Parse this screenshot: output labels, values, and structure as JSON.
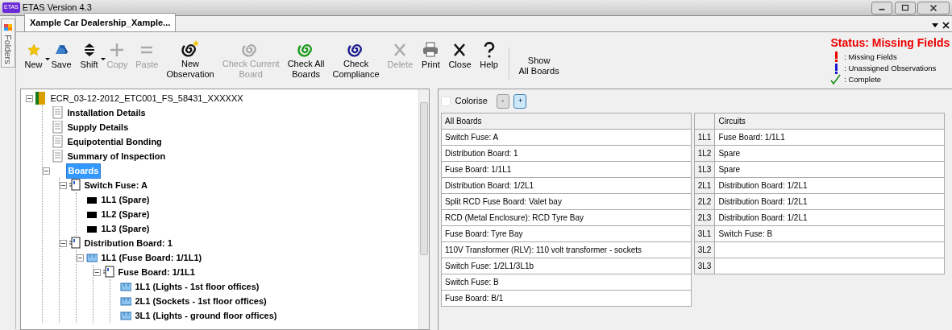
{
  "window": {
    "title": "ETAS Version 4.3",
    "app_badge": "ETAS"
  },
  "side_panel": {
    "label": "Folders"
  },
  "document_tab": {
    "label": "Xample Car Dealership_Xample...",
    "selected": true
  },
  "toolbar": [
    {
      "label": "New",
      "kind": "star",
      "disabled": false,
      "dropdown": true
    },
    {
      "label": "Save",
      "kind": "save",
      "disabled": false,
      "dropdown": false
    },
    {
      "label": "Shift",
      "kind": "shift",
      "disabled": false,
      "dropdown": true
    },
    {
      "label": "Copy",
      "kind": "plus",
      "disabled": true,
      "dropdown": false
    },
    {
      "label": "Paste",
      "kind": "equals",
      "disabled": true,
      "dropdown": false
    },
    {
      "label": "New Observation",
      "kind": "spiralstar",
      "disabled": false,
      "dropdown": false
    },
    {
      "label": "Check Current Board",
      "kind": "spiralgrey",
      "disabled": true,
      "dropdown": false
    },
    {
      "label": "Check All Boards",
      "kind": "spiralgreen",
      "disabled": false,
      "dropdown": false
    },
    {
      "label": "Check Compliance",
      "kind": "spiralblue",
      "disabled": false,
      "dropdown": false
    },
    {
      "label": "Delete",
      "kind": "cross",
      "disabled": true,
      "dropdown": false
    },
    {
      "label": "Print",
      "kind": "printer",
      "disabled": false,
      "dropdown": false
    },
    {
      "label": "Close",
      "kind": "cross",
      "disabled": false,
      "dropdown": false
    },
    {
      "label": "Help",
      "kind": "question",
      "disabled": false,
      "dropdown": false
    },
    {
      "label": "Show All Boards",
      "kind": "text",
      "disabled": false,
      "dropdown": false
    }
  ],
  "status": {
    "title": "Status: Missing Fields",
    "legend": [
      {
        "kind": "missing",
        "label": ": Missing Fields"
      },
      {
        "kind": "unassigned",
        "label": ": Unassigned Observations"
      },
      {
        "kind": "complete",
        "label": ": Complete"
      }
    ]
  },
  "tree": [
    {
      "label": "ECR_03-12-2012_ETC001_FS_58431_XXXXXX",
      "kind": "root",
      "selected": false,
      "expanded": true,
      "children": [
        {
          "label": "Installation Details",
          "kind": "doc",
          "selected": false
        },
        {
          "label": "Supply Details",
          "kind": "doc",
          "selected": false
        },
        {
          "label": "Equipotential Bonding",
          "kind": "doc",
          "selected": false
        },
        {
          "label": "Summary of Inspection",
          "kind": "doc",
          "selected": false
        },
        {
          "label": "Boards",
          "kind": "group",
          "selected": true,
          "expanded": true,
          "children": [
            {
              "label": "Switch Fuse: A",
              "kind": "board",
              "selected": false,
              "expanded": true,
              "children": [
                {
                  "label": "1L1 (Spare)",
                  "kind": "spare",
                  "selected": false
                },
                {
                  "label": "1L2 (Spare)",
                  "kind": "spare",
                  "selected": false
                },
                {
                  "label": "1L3 (Spare)",
                  "kind": "spare",
                  "selected": false
                }
              ]
            },
            {
              "label": "Distribution Board: 1",
              "kind": "board",
              "selected": false,
              "expanded": true,
              "children": [
                {
                  "label": "1L1 (Fuse Board: 1/1L1)",
                  "kind": "circuit",
                  "selected": false,
                  "expanded": true,
                  "children": [
                    {
                      "label": "Fuse Board: 1/1L1",
                      "kind": "board",
                      "selected": false,
                      "expanded": true,
                      "children": [
                        {
                          "label": "1L1 (Lights - 1st floor offices)",
                          "kind": "circuit",
                          "selected": false
                        },
                        {
                          "label": "2L1 (Sockets - 1st floor offices)",
                          "kind": "circuit",
                          "selected": false
                        },
                        {
                          "label": "3L1 (Lights - ground floor offices)",
                          "kind": "circuit",
                          "selected": false
                        }
                      ]
                    }
                  ]
                }
              ]
            }
          ]
        }
      ]
    }
  ],
  "controls": {
    "colorise": {
      "label": "Colorise",
      "checked": false
    },
    "buttons": [
      {
        "label": "-",
        "hover": false
      },
      {
        "label": "+",
        "hover": true
      }
    ]
  },
  "boards_table": {
    "columns": [
      "All Boards"
    ],
    "rows": [
      "Switch Fuse: A",
      "Distribution Board: 1",
      "Fuse Board: 1/1L1",
      "Distribution Board: 1/2L1",
      "Split RCD Fuse Board: Valet bay",
      "RCD (Metal Enclosure): RCD Tyre Bay",
      "Fuse Board: Tyre Bay",
      "110V Transformer (RLV): 110 volt transformer - sockets",
      "Switch Fuse: 1/2L1/3L1b",
      "Switch Fuse: B",
      "Fuse Board: B/1"
    ]
  },
  "circuits_table": {
    "columns": [
      "Circuits"
    ],
    "rows": [
      {
        "id": "1L1",
        "value": "Fuse Board: 1/1L1"
      },
      {
        "id": "1L2",
        "value": "Spare"
      },
      {
        "id": "1L3",
        "value": "Spare"
      },
      {
        "id": "2L1",
        "value": "Distribution Board: 1/2L1"
      },
      {
        "id": "2L2",
        "value": "Distribution Board: 1/2L1"
      },
      {
        "id": "2L3",
        "value": "Distribution Board: 1/2L1"
      },
      {
        "id": "3L1",
        "value": "Switch Fuse: B"
      },
      {
        "id": "3L2"
      },
      {
        "id": "3L3"
      }
    ]
  }
}
